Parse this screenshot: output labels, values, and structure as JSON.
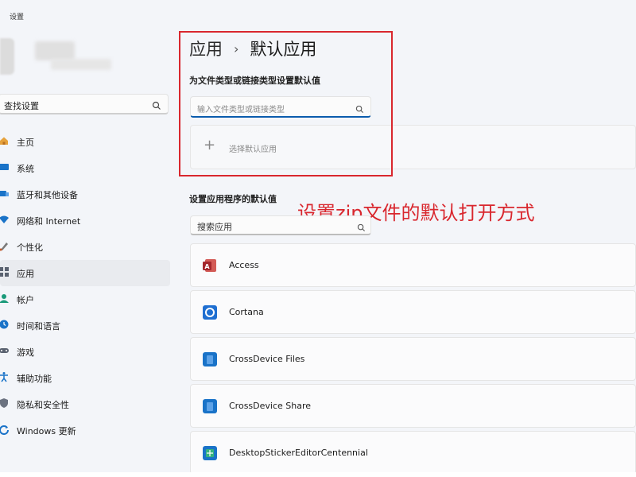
{
  "window": {
    "title": "设置"
  },
  "sidebar": {
    "search_value": "查找设置",
    "items": [
      {
        "label": "主页",
        "icon": "home-icon",
        "active": false
      },
      {
        "label": "系统",
        "icon": "system-icon",
        "active": false
      },
      {
        "label": "蓝牙和其他设备",
        "icon": "bluetooth-icon",
        "active": false
      },
      {
        "label": "网络和 Internet",
        "icon": "network-icon",
        "active": false
      },
      {
        "label": "个性化",
        "icon": "personalization-icon",
        "active": false
      },
      {
        "label": "应用",
        "icon": "apps-icon",
        "active": true
      },
      {
        "label": "帐户",
        "icon": "account-icon",
        "active": false
      },
      {
        "label": "时间和语言",
        "icon": "time-language-icon",
        "active": false
      },
      {
        "label": "游戏",
        "icon": "gaming-icon",
        "active": false
      },
      {
        "label": "辅助功能",
        "icon": "accessibility-icon",
        "active": false
      },
      {
        "label": "隐私和安全性",
        "icon": "privacy-shield-icon",
        "active": false
      },
      {
        "label": "Windows 更新",
        "icon": "windows-update-icon",
        "active": false
      }
    ]
  },
  "header": {
    "breadcrumb_parent": "应用",
    "breadcrumb_separator": "›",
    "breadcrumb_current": "默认应用"
  },
  "filetype_section": {
    "title": "为文件类型或链接类型设置默认值",
    "input_placeholder": "输入文件类型或链接类型",
    "choose_label": "选择默认应用"
  },
  "apps_section": {
    "title": "设置应用程序的默认值",
    "search_placeholder": "搜索应用",
    "apps": [
      {
        "name": "Access",
        "icon": "access-icon",
        "color": "#b7302c"
      },
      {
        "name": "Cortana",
        "icon": "cortana-icon",
        "color": "#1f6fd1"
      },
      {
        "name": "CrossDevice Files",
        "icon": "crossdevice-files-icon",
        "color": "#1a73c8"
      },
      {
        "name": "CrossDevice Share",
        "icon": "crossdevice-share-icon",
        "color": "#1a73c8"
      },
      {
        "name": "DesktopStickerEditorCentennial",
        "icon": "sticker-editor-icon",
        "color": "#1a73c8"
      }
    ]
  },
  "annotation": {
    "text": "设置zip文件的默认打开方式",
    "color": "#d9272e"
  },
  "colors": {
    "accent": "#0b5cad",
    "highlight_red": "#d9272e",
    "background": "#f3f5f9"
  }
}
